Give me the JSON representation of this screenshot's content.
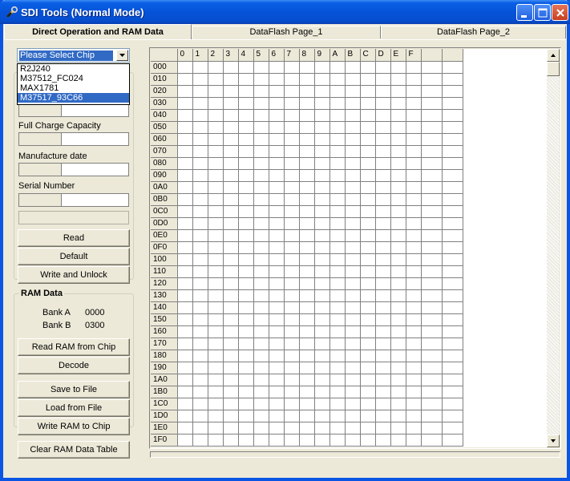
{
  "window": {
    "title": "SDI Tools (Normal Mode)"
  },
  "tabs": [
    {
      "label": "Direct Operation   and   RAM Data",
      "active": true
    },
    {
      "label": "DataFlash Page_1",
      "active": false
    },
    {
      "label": "DataFlash Page_2",
      "active": false
    }
  ],
  "chip_select": {
    "value": "Please Select Chip",
    "options": [
      "R2J240",
      "M37512_FC024",
      "MAX1781",
      "M37517_93C66"
    ],
    "highlighted": "M37517_93C66"
  },
  "fields": {
    "full_charge_capacity": "Full Charge Capacity",
    "manufacture_date": "Manufacture date",
    "serial_number": "Serial Number"
  },
  "buttons": {
    "read": "Read",
    "default": "Default",
    "write_unlock": "Write and Unlock",
    "read_ram": "Read RAM from Chip",
    "decode": "Decode",
    "save_file": "Save  to  File",
    "load_file": "Load from File",
    "write_ram": "Write RAM to Chip",
    "clear_ram": "Clear RAM Data Table"
  },
  "ram": {
    "title": "RAM Data",
    "bank_a_label": "Bank A",
    "bank_a_value": "0000",
    "bank_b_label": "Bank B",
    "bank_b_value": "0300"
  },
  "grid": {
    "columns": [
      "0",
      "1",
      "2",
      "3",
      "4",
      "5",
      "6",
      "7",
      "8",
      "9",
      "A",
      "B",
      "C",
      "D",
      "E",
      "F"
    ],
    "rows": [
      "000",
      "010",
      "020",
      "030",
      "040",
      "050",
      "060",
      "070",
      "080",
      "090",
      "0A0",
      "0B0",
      "0C0",
      "0D0",
      "0E0",
      "0F0",
      "100",
      "110",
      "120",
      "130",
      "140",
      "150",
      "160",
      "170",
      "180",
      "190",
      "1A0",
      "1B0",
      "1C0",
      "1D0",
      "1E0",
      "1F0"
    ]
  },
  "colors": {
    "titlebar": "#0553d8",
    "selection": "#316ac5",
    "face": "#ece9d8"
  }
}
